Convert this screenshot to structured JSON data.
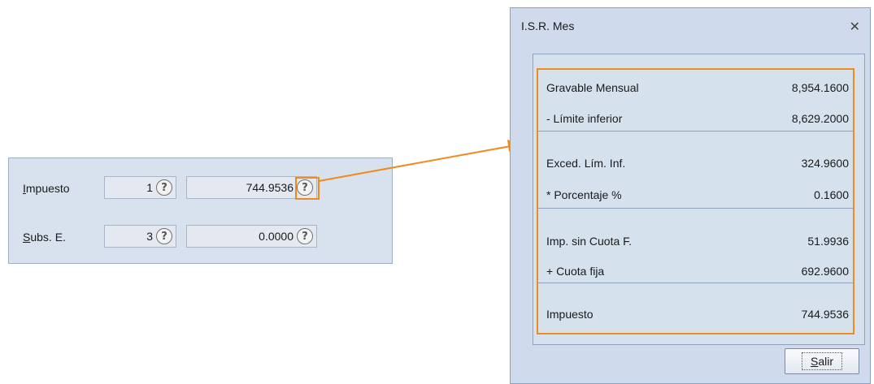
{
  "form": {
    "rows": [
      {
        "label_ul": "I",
        "label_rest": "mpuesto",
        "small_value": "1",
        "large_value": "744.9536"
      },
      {
        "label_ul": "S",
        "label_rest": "ubs. E.",
        "small_value": "3",
        "large_value": "0.0000"
      }
    ],
    "help_icon_glyph": "?"
  },
  "dialog": {
    "title": "I.S.R. Mes",
    "close_glyph": "✕",
    "rows": [
      {
        "label": "Gravable Mensual",
        "value": "8,954.1600"
      },
      {
        "label": "- Límite inferior",
        "value": "8,629.2000"
      },
      {
        "label": "Exced. Lím. Inf.",
        "value": "324.9600"
      },
      {
        "label": "* Porcentaje %",
        "value": "0.1600"
      },
      {
        "label": "Imp. sin Cuota F.",
        "value": "51.9936"
      },
      {
        "label": "+ Cuota fija",
        "value": "692.9600"
      },
      {
        "label": "Impuesto",
        "value": "744.9536"
      }
    ],
    "salir_ul": "S",
    "salir_rest": "alir"
  },
  "colors": {
    "highlight": "#f08a1e",
    "panel_bg": "#d8e2ef",
    "dialog_bg": "#cfdbec"
  },
  "icons": {
    "help": "help-question-circle-icon",
    "close": "close-icon"
  }
}
